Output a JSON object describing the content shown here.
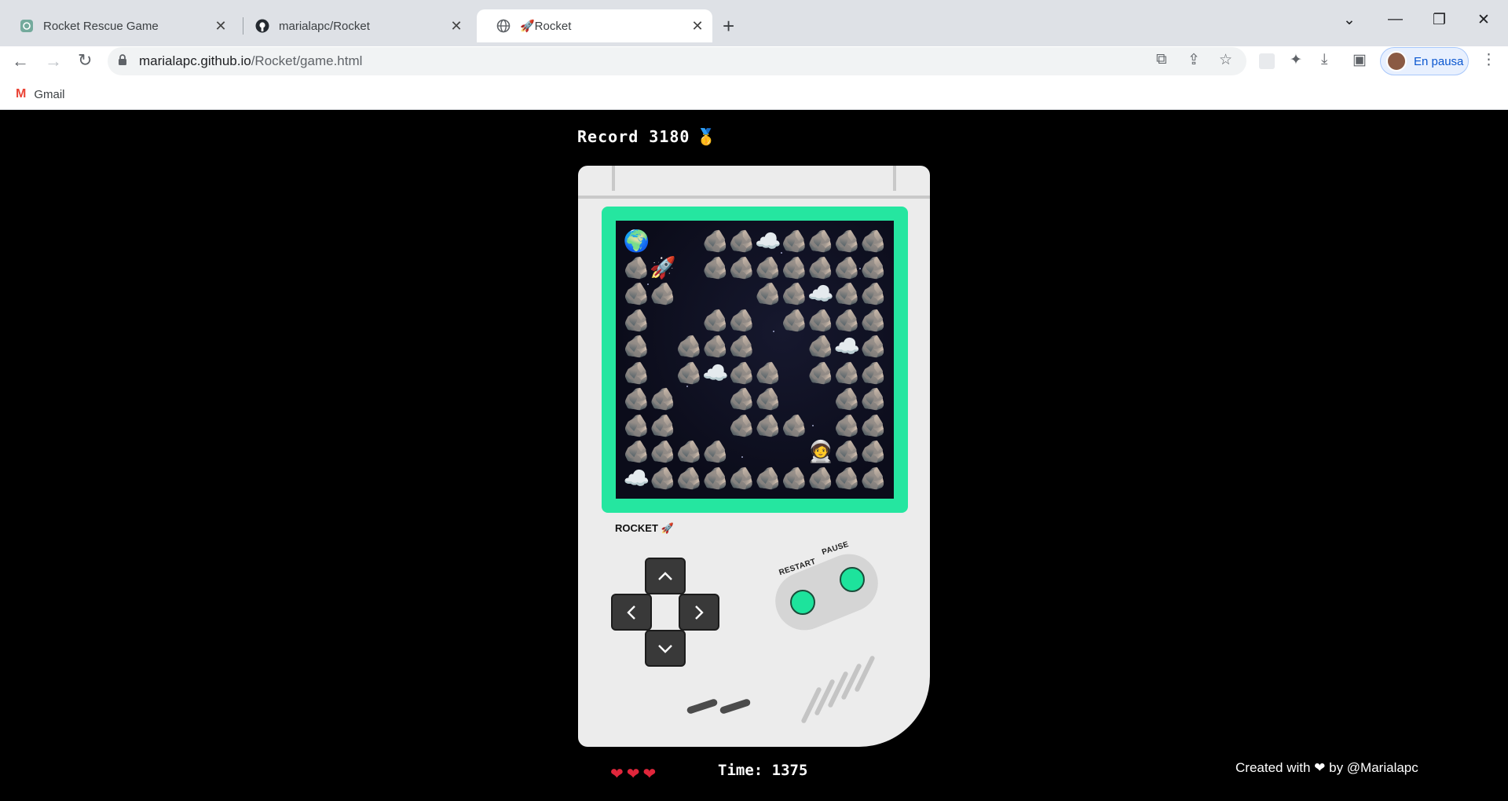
{
  "browser": {
    "tabs": [
      {
        "title": "Rocket Rescue Game",
        "icon": "chatgpt-icon"
      },
      {
        "title": "marialapc/Rocket",
        "icon": "github-icon"
      },
      {
        "title": "🚀Rocket",
        "icon": "globe-icon",
        "active": true
      }
    ],
    "url_host": "marialapc.github.io",
    "url_path": "/Rocket/game.html",
    "profile_label": "En pausa",
    "bookmark_gmail": "Gmail"
  },
  "game": {
    "record_label": "Record 3180",
    "record_medal": "🥇",
    "brand_label": "ROCKET 🚀",
    "restart_label": "RESTART",
    "pause_label": "PAUSE",
    "lives": "❤❤❤",
    "time_label": "Time: 1375",
    "credit": "Created with ❤ by @Marialapc",
    "map_legend": {
      "X": "🪨",
      "W": "🌍",
      "R": "🚀",
      "C": "☁️",
      "A": "🧑‍🚀",
      "-": ""
    },
    "map": [
      "W--XXCXXXX",
      "XR-XXXXXXX",
      "XX---XXCXX",
      "X--XX-XXXX",
      "X-XXX--XCX",
      "X-XCXX-XXX",
      "XX--XX--XX",
      "XX--XXX-XX",
      "XXXX---AXX",
      "CXXXXXXXXX"
    ]
  },
  "colors": {
    "screen_frame": "#25e6a0",
    "button_green": "#1de39c",
    "console_body": "#ececec",
    "dpad": "#393939"
  }
}
